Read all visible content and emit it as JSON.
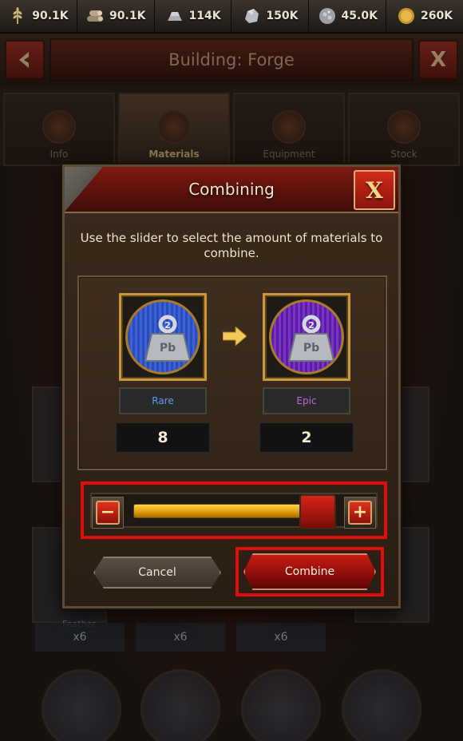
{
  "resources": [
    {
      "icon": "wheat-icon",
      "value": "90.1K"
    },
    {
      "icon": "wood-logs-icon",
      "value": "90.1K"
    },
    {
      "icon": "iron-ingots-icon",
      "value": "114K"
    },
    {
      "icon": "stone-icon",
      "value": "150K"
    },
    {
      "icon": "silver-ore-icon",
      "value": "45.0K"
    },
    {
      "icon": "gold-coin-icon",
      "value": "260K"
    }
  ],
  "header": {
    "title": "Building: Forge",
    "back_icon": "chevron-left-icon",
    "close_label": "X"
  },
  "tabs": [
    {
      "label": "Info",
      "active": false
    },
    {
      "label": "Materials",
      "active": true
    },
    {
      "label": "Equipment",
      "active": false
    },
    {
      "label": "Stock",
      "active": false
    }
  ],
  "background": {
    "item_name": "Feather",
    "quantities": [
      "x6",
      "x6",
      "x6"
    ]
  },
  "modal": {
    "title": "Combining",
    "close_label": "X",
    "instruction": "Use the slider to select the amount of materials to combine.",
    "source": {
      "tier": "Rare",
      "tier_color": "#5d9de8",
      "count": "8",
      "icon": "lead-weight-icon",
      "badge": "2",
      "label": "Pb"
    },
    "target": {
      "tier": "Epic",
      "tier_color": "#b56ae0",
      "count": "2",
      "icon": "lead-weight-icon",
      "badge": "2",
      "label": "Pb"
    },
    "slider": {
      "fraction": 1.0,
      "minus_label": "−",
      "plus_label": "+"
    },
    "cancel_label": "Cancel",
    "combine_label": "Combine"
  },
  "colors": {
    "accent_red": "#c61c14",
    "highlight": "#e10c0c",
    "gold": "#c9973a"
  }
}
